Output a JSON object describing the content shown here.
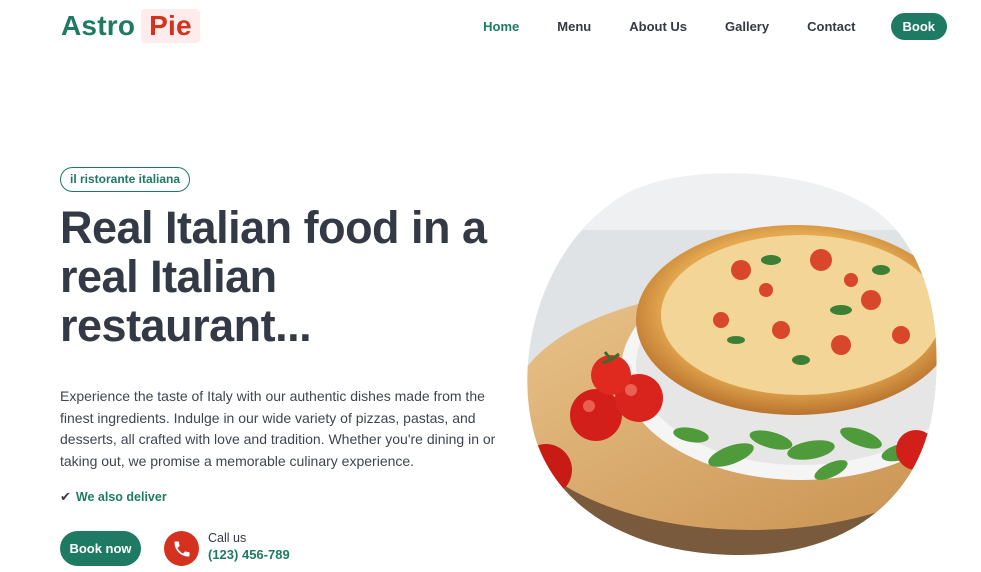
{
  "brand": {
    "part1": "Astro",
    "part2": "Pie"
  },
  "nav": {
    "items": [
      {
        "label": "Home",
        "active": true
      },
      {
        "label": "Menu"
      },
      {
        "label": "About Us"
      },
      {
        "label": "Gallery"
      },
      {
        "label": "Contact"
      }
    ],
    "book_label": "Book"
  },
  "hero": {
    "badge": "il ristorante italiana",
    "headline": "Real Italian food in a real Italian restaurant...",
    "description": "Experience the taste of Italy with our authentic dishes made from the finest ingredients. Indulge in our wide variety of pizzas, pastas, and desserts, all crafted with love and tradition. Whether you're dining in or taking out, we promise a memorable culinary experience.",
    "deliver_note": "We also deliver",
    "cta_label": "Book now",
    "call_label": "Call us",
    "phone": "(123) 456-789"
  },
  "icons": {
    "check": "check-icon",
    "phone": "phone-icon"
  },
  "colors": {
    "accent": "#1f7a63",
    "brand_red": "#d4311f",
    "text": "#333a45"
  }
}
